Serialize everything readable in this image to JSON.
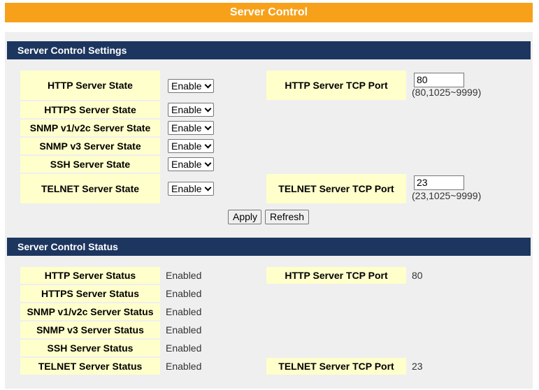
{
  "page": {
    "title": "Server Control"
  },
  "settings": {
    "header": "Server Control Settings",
    "rows": [
      {
        "label": "HTTP Server State",
        "value": "Enable"
      },
      {
        "label": "HTTPS Server State",
        "value": "Enable"
      },
      {
        "label": "SNMP v1/v2c Server State",
        "value": "Enable"
      },
      {
        "label": "SNMP v3 Server State",
        "value": "Enable"
      },
      {
        "label": "SSH Server State",
        "value": "Enable"
      },
      {
        "label": "TELNET Server State",
        "value": "Enable"
      }
    ],
    "http_port": {
      "label": "HTTP Server TCP Port",
      "value": "80",
      "hint": "(80,1025~9999)"
    },
    "telnet_port": {
      "label": "TELNET Server TCP Port",
      "value": "23",
      "hint": "(23,1025~9999)"
    },
    "apply_label": "Apply",
    "refresh_label": "Refresh"
  },
  "status": {
    "header": "Server Control Status",
    "rows": [
      {
        "label": "HTTP Server Status",
        "value": "Enabled"
      },
      {
        "label": "HTTPS Server Status",
        "value": "Enabled"
      },
      {
        "label": "SNMP v1/v2c Server Status",
        "value": "Enabled"
      },
      {
        "label": "SNMP v3 Server Status",
        "value": "Enabled"
      },
      {
        "label": "SSH Server Status",
        "value": "Enabled"
      },
      {
        "label": "TELNET Server Status",
        "value": "Enabled"
      }
    ],
    "http_port": {
      "label": "HTTP Server TCP Port",
      "value": "80"
    },
    "telnet_port": {
      "label": "TELNET Server TCP Port",
      "value": "23"
    }
  }
}
